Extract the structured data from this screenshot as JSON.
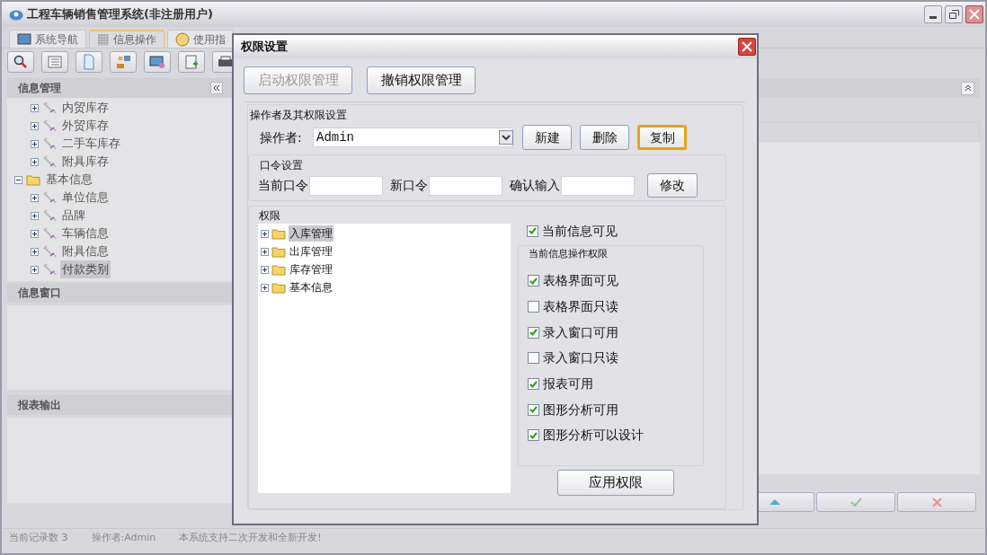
{
  "window": {
    "title": "工程车辆销售管理系统(非注册用户)"
  },
  "tabs": [
    {
      "label": "系统导航",
      "selected": false,
      "kind": "monitor"
    },
    {
      "label": "信息操作",
      "selected": true,
      "kind": "grid"
    },
    {
      "label": "使用指",
      "selected": false,
      "kind": "help"
    }
  ],
  "toolbar": [
    {
      "kind": "search"
    },
    {
      "kind": "list"
    },
    {
      "kind": "document"
    },
    {
      "kind": "user"
    },
    {
      "kind": "screen"
    },
    {
      "kind": "form"
    },
    {
      "kind": "print"
    }
  ],
  "left_panel": {
    "title": "信息管理",
    "tree": [
      {
        "label": "内贸库存",
        "kind": "module",
        "selected": false
      },
      {
        "label": "外贸库存",
        "kind": "module",
        "selected": false
      },
      {
        "label": "二手车库存",
        "kind": "module",
        "selected": false
      },
      {
        "label": "附具库存",
        "kind": "module",
        "selected": false
      },
      {
        "label": "基本信息",
        "kind": "folder",
        "expanded": true,
        "selected": false,
        "children": [
          {
            "label": "单位信息",
            "kind": "module",
            "selected": false
          },
          {
            "label": "品牌",
            "kind": "module",
            "selected": false
          },
          {
            "label": "车辆信息",
            "kind": "module",
            "selected": false
          },
          {
            "label": "附具信息",
            "kind": "module",
            "selected": false
          },
          {
            "label": "付款类别",
            "kind": "module",
            "selected": true
          }
        ]
      }
    ]
  },
  "info_window": {
    "title": "信息窗口"
  },
  "report_output": {
    "title": "报表输出"
  },
  "bottom_buttons": [
    {
      "kind": "up"
    },
    {
      "kind": "ok"
    },
    {
      "kind": "cancel"
    }
  ],
  "status_bar": [
    "当前记录数 3",
    "操作者:Admin",
    "本系统支持二次开发和全新开发!"
  ],
  "dialog": {
    "title": "权限设置",
    "top_buttons": [
      {
        "label": "启动权限管理",
        "disabled": true
      },
      {
        "label": "撤销权限管理",
        "disabled": false
      }
    ],
    "operator_group": {
      "title": "操作者及其权限设置",
      "label": "操作者:",
      "value": "Admin",
      "buttons": [
        {
          "label": "新建",
          "focused": false
        },
        {
          "label": "删除",
          "focused": false
        },
        {
          "label": "复制",
          "focused": true
        }
      ]
    },
    "password_group": {
      "title": "口令设置",
      "fields": [
        {
          "label": "当前口令"
        },
        {
          "label": "新口令"
        },
        {
          "label": "确认输入"
        }
      ],
      "button": "修改"
    },
    "permissions": {
      "title": "权限",
      "tree": [
        {
          "label": "入库管理",
          "expanded": false,
          "selected": true
        },
        {
          "label": "出库管理",
          "expanded": false,
          "selected": false
        },
        {
          "label": "库存管理",
          "expanded": false,
          "selected": false
        },
        {
          "label": "基本信息",
          "expanded": false,
          "selected": false
        }
      ],
      "visible": {
        "label": "当前信息可见",
        "checked": true
      },
      "ops_title": "当前信息操作权限",
      "ops": [
        {
          "label": "表格界面可见",
          "checked": true
        },
        {
          "label": "表格界面只读",
          "checked": false
        },
        {
          "label": "录入窗口可用",
          "checked": true
        },
        {
          "label": "录入窗口只读",
          "checked": false
        },
        {
          "label": "报表可用",
          "checked": true
        },
        {
          "label": "图形分析可用",
          "checked": true
        },
        {
          "label": "图形分析可以设计",
          "checked": true
        }
      ],
      "apply_button": "应用权限"
    }
  }
}
